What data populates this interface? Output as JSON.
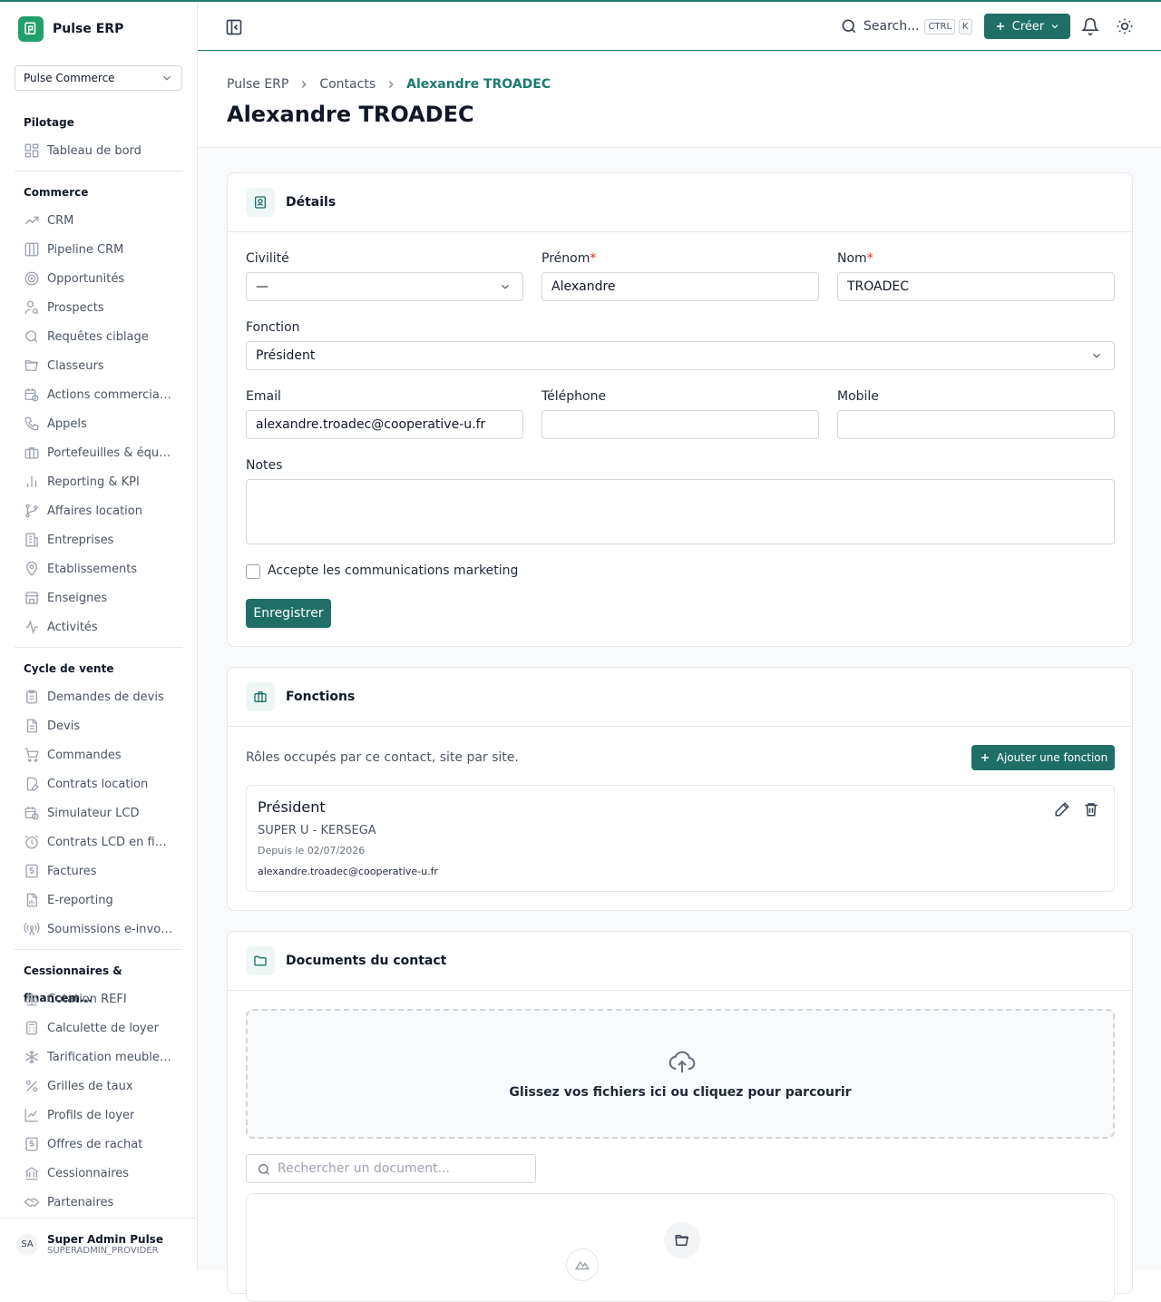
{
  "app": {
    "name": "Pulse ERP"
  },
  "org_selector": {
    "value": "Pulse Commerce"
  },
  "sidebar": {
    "sections": [
      {
        "title": "Pilotage",
        "items": [
          {
            "label": "Tableau de bord",
            "icon": "dashboard-icon"
          }
        ]
      },
      {
        "title": "Commerce",
        "items": [
          {
            "label": "CRM",
            "icon": "trending-up-icon"
          },
          {
            "label": "Pipeline CRM",
            "icon": "kanban-icon"
          },
          {
            "label": "Opportunités",
            "icon": "target-icon"
          },
          {
            "label": "Prospects",
            "icon": "user-search-icon"
          },
          {
            "label": "Requêtes ciblage",
            "icon": "search-icon"
          },
          {
            "label": "Classeurs",
            "icon": "folder-open-icon"
          },
          {
            "label": "Actions commerciales",
            "icon": "calendar-clock-icon"
          },
          {
            "label": "Appels",
            "icon": "phone-icon"
          },
          {
            "label": "Portefeuilles & équipe",
            "icon": "briefcase-icon"
          },
          {
            "label": "Reporting & KPI",
            "icon": "bar-chart-icon"
          },
          {
            "label": "Affaires location",
            "icon": "git-branch-icon"
          },
          {
            "label": "Entreprises",
            "icon": "building-icon"
          },
          {
            "label": "Établissements",
            "icon": "map-pin-icon"
          },
          {
            "label": "Enseignes",
            "icon": "store-icon"
          },
          {
            "label": "Activités",
            "icon": "activity-icon"
          }
        ]
      },
      {
        "title": "Cycle de vente",
        "items": [
          {
            "label": "Demandes de devis",
            "icon": "clipboard-list-icon"
          },
          {
            "label": "Devis",
            "icon": "file-text-icon"
          },
          {
            "label": "Commandes",
            "icon": "shopping-cart-icon"
          },
          {
            "label": "Contrats location",
            "icon": "file-edit-icon"
          },
          {
            "label": "Simulateur LCD",
            "icon": "calendar-clock-icon"
          },
          {
            "label": "Contrats LCD en fin ...",
            "icon": "alarm-clock-icon"
          },
          {
            "label": "Factures",
            "icon": "receipt-dollar-icon"
          },
          {
            "label": "E-reporting",
            "icon": "file-chart-icon"
          },
          {
            "label": "Soumissions e-invoice",
            "icon": "radio-tower-icon"
          }
        ]
      },
      {
        "title": "Cessionnaires & financem...",
        "items": [
          {
            "label": "Cotation REFI",
            "icon": "scale-icon"
          },
          {
            "label": "Calculette de loyer",
            "icon": "calculator-icon"
          },
          {
            "label": "Tarification meubles ...",
            "icon": "snowflake-icon"
          },
          {
            "label": "Grilles de taux",
            "icon": "percent-icon"
          },
          {
            "label": "Profils de loyer",
            "icon": "line-chart-icon"
          },
          {
            "label": "Offres de rachat",
            "icon": "receipt-dollar-icon"
          },
          {
            "label": "Cessionnaires",
            "icon": "bank-icon"
          },
          {
            "label": "Partenaires",
            "icon": "handshake-icon"
          }
        ]
      }
    ]
  },
  "user": {
    "initials": "SA",
    "name": "Super Admin Pulse",
    "role": "SUPERADMIN_PROVIDER"
  },
  "topbar": {
    "search_label": "Search...",
    "kbd": [
      "CTRL",
      "K"
    ],
    "create_label": "Créer"
  },
  "breadcrumb": [
    "Pulse ERP",
    "Contacts",
    "Alexandre TROADEC"
  ],
  "page_title": "Alexandre TROADEC",
  "details": {
    "title": "Détails",
    "civilite": {
      "label": "Civilité",
      "value": "—"
    },
    "prenom": {
      "label": "Prénom",
      "value": "Alexandre"
    },
    "nom": {
      "label": "Nom",
      "value": "TROADEC"
    },
    "required_mark": "*",
    "fonction": {
      "label": "Fonction",
      "value": "Président"
    },
    "email": {
      "label": "Email",
      "value": "alexandre.troadec@cooperative-u.fr"
    },
    "telephone": {
      "label": "Téléphone",
      "value": ""
    },
    "mobile": {
      "label": "Mobile",
      "value": ""
    },
    "notes": {
      "label": "Notes",
      "value": ""
    },
    "marketing": {
      "label": "Accepte les communications marketing",
      "checked": false
    },
    "save_label": "Enregistrer"
  },
  "fonctions": {
    "title": "Fonctions",
    "description": "Rôles occupés par ce contact, site par site.",
    "add_label": "Ajouter une fonction",
    "items": [
      {
        "role": "Président",
        "site": "SUPER U - KERSEGA",
        "since": "Depuis le 02/07/2026",
        "email": "alexandre.troadec@cooperative-u.fr"
      }
    ]
  },
  "documents": {
    "title": "Documents du contact",
    "dropzone_text": "Glissez vos fichiers ici ou cliquez pour parcourir",
    "search_placeholder": "Rechercher un document..."
  },
  "colors": {
    "accent": "#1f6f66",
    "accent_text": "#1f7a6e",
    "required": "#dc2626"
  }
}
